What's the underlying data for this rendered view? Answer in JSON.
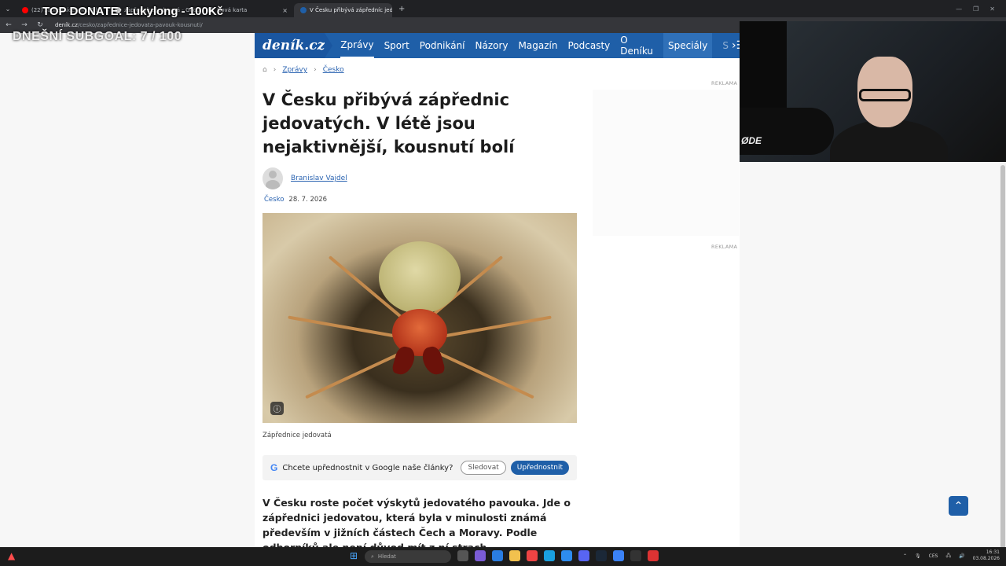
{
  "overlay": {
    "donate": "TOP DONATE: Lukylong - 100Kč",
    "subgoal": "DNEŠNÍ SUBGOAL: 7 / 100"
  },
  "browser": {
    "tabs": [
      {
        "label": "(22) zápředníce - YouTube",
        "icon_color": "#ff0000"
      },
      {
        "label": "zápředníce jedovatá - Google Search",
        "icon_color": "#ffffff"
      },
      {
        "label": "Nová karta",
        "icon_color": "#9aa0a6"
      },
      {
        "label": "V Česku přibývá zápředníc jedo",
        "icon_color": "#1f5fa8"
      }
    ],
    "url_host": "deník.cz",
    "url_path": "/cesko/zapřednice-jedovata-pavouk-kousnuti/",
    "new_tab": "+",
    "tab_close": "×",
    "nav_back": "←",
    "nav_forward": "→",
    "nav_reload": "↻"
  },
  "site": {
    "logo": "deník.cz",
    "nav": [
      "Zprávy",
      "Sport",
      "Podnikání",
      "Názory",
      "Magazín",
      "Podcasty",
      "O Deníku",
      "Speciály"
    ],
    "nav_cut": "S",
    "breadcrumb": [
      "Zprávy",
      "Česko"
    ]
  },
  "article": {
    "title": "V Česku přibývá zápřednic jedovatých. V létě jsou nejaktivnější, kousnutí bolí",
    "author": "Branislav Vajdel",
    "category": "Česko",
    "date": "28. 7. 2026",
    "photo_caption": "Zápřednice jedovatá",
    "google_prompt": "Chcete upřednostnit v Google naše články?",
    "follow_label": "Sledovat",
    "prefer_label": "Upřednostnit",
    "lead": "V Česku roste počet výskytů jedovatého pavouka. Jde o zápřednici jedovatou, která byla v minulosti známá především v jižních částech Čech a Moravy. Podle odborníků ale není důvod mít z ní strach."
  },
  "ads": {
    "label": "REKLAMA"
  },
  "webcam": {
    "mic_brand": "ØDE"
  },
  "taskbar": {
    "search_placeholder": "Hledat",
    "lang": "CES",
    "time": "16:31",
    "date": "03.08.2026"
  },
  "colors": {
    "brand": "#1f5fa8",
    "link": "#2a63b1"
  }
}
